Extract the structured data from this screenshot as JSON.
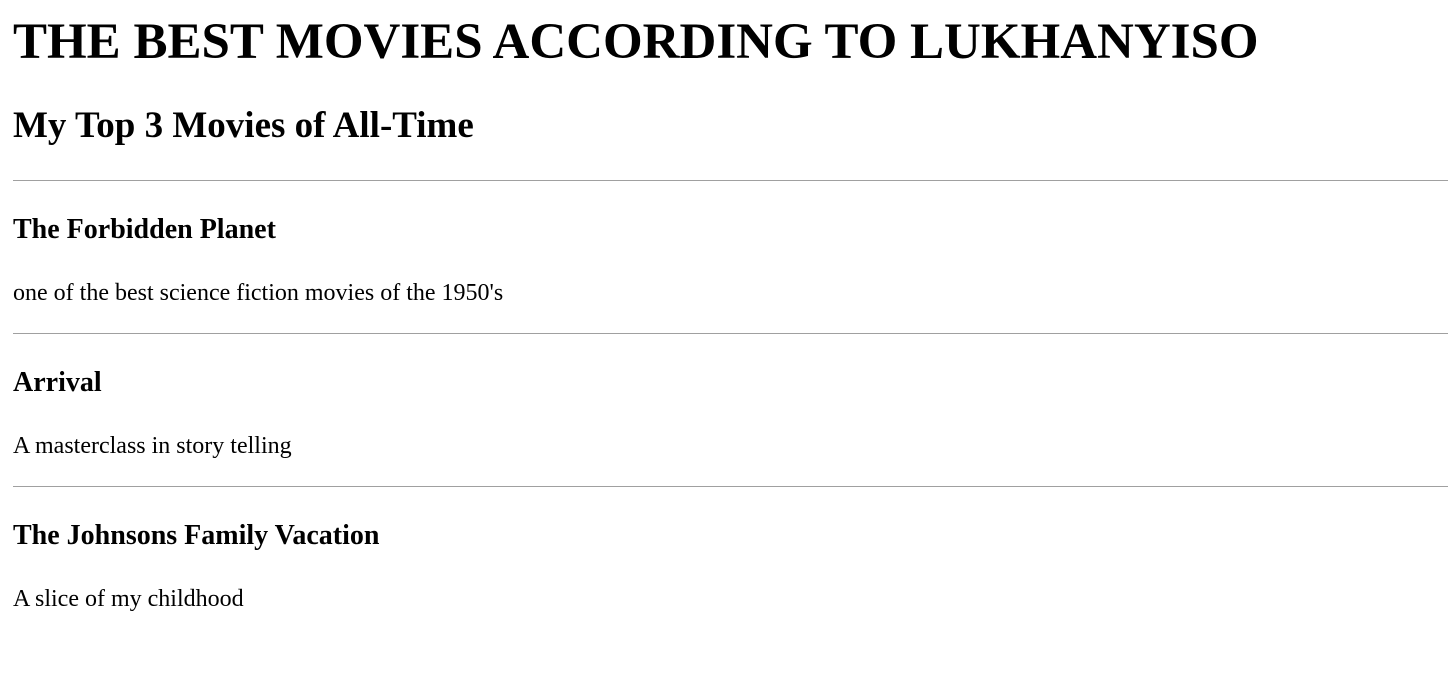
{
  "page": {
    "title": "THE BEST MOVIES ACCORDING TO LUKHANYISO",
    "subtitle": "My Top 3 Movies of All-Time"
  },
  "movies": [
    {
      "title": "The Forbidden Planet",
      "description": "one of the best science fiction movies of the 1950's"
    },
    {
      "title": "Arrival",
      "description": "A masterclass in story telling"
    },
    {
      "title": "The Johnsons Family Vacation",
      "description": "A slice of my childhood"
    }
  ],
  "colors": {
    "text": "#000000",
    "background": "#ffffff",
    "divider": "#a0a0a0"
  }
}
